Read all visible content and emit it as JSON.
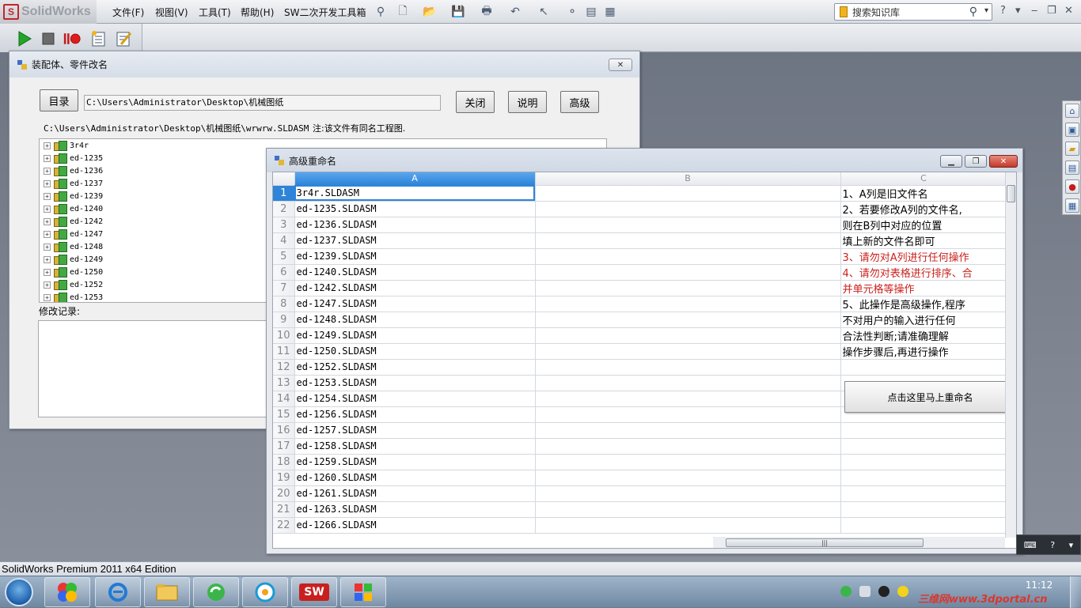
{
  "app": {
    "logo_text": "SolidWorks",
    "logo_mark": "S",
    "menu": [
      "文件(F)",
      "视图(V)",
      "工具(T)",
      "帮助(H)",
      "SW二次开发工具箱"
    ],
    "search_placeholder": "搜索知识库",
    "help_glyph": "?",
    "status_text": "SolidWorks Premium 2011 x64 Edition"
  },
  "rename_dialog": {
    "title": "装配体、零件改名",
    "close_glyph": "✕",
    "dir_button": "目录",
    "path_value": "C:\\Users\\Administrator\\Desktop\\机械图纸",
    "close_button": "关闭",
    "help_button": "说明",
    "advanced_button": "高级",
    "file_path": "C:\\Users\\Administrator\\Desktop\\机械图纸\\wrwrw.SLDASM",
    "note": "注:该文件有同名工程图.",
    "tree_items": [
      "3r4r",
      "ed-1235",
      "ed-1236",
      "ed-1237",
      "ed-1239",
      "ed-1240",
      "ed-1242",
      "ed-1247",
      "ed-1248",
      "ed-1249",
      "ed-1250",
      "ed-1252",
      "ed-1253"
    ],
    "log_label": "修改记录:"
  },
  "advanced_dialog": {
    "title": "高级重命名",
    "columns": [
      "A",
      "B",
      "C"
    ],
    "rows": [
      {
        "num": "1",
        "a": "3r4r.SLDASM",
        "c": "1、A列是旧文件名",
        "red": false
      },
      {
        "num": "2",
        "a": "ed-1235.SLDASM",
        "c": "2、若要修改A列的文件名,",
        "red": false
      },
      {
        "num": "3",
        "a": "ed-1236.SLDASM",
        "c": "则在B列中对应的位置",
        "red": false
      },
      {
        "num": "4",
        "a": "ed-1237.SLDASM",
        "c": "填上新的文件名即可",
        "red": false
      },
      {
        "num": "5",
        "a": "ed-1239.SLDASM",
        "c": "3、请勿对A列进行任何操作",
        "red": true
      },
      {
        "num": "6",
        "a": "ed-1240.SLDASM",
        "c": "4、请勿对表格进行排序、合",
        "red": true
      },
      {
        "num": "7",
        "a": "ed-1242.SLDASM",
        "c": "并单元格等操作",
        "red": true
      },
      {
        "num": "8",
        "a": "ed-1247.SLDASM",
        "c": "5、此操作是高级操作,程序",
        "red": false
      },
      {
        "num": "9",
        "a": "ed-1248.SLDASM",
        "c": "不对用户的输入进行任何",
        "red": false
      },
      {
        "num": "10",
        "a": "ed-1249.SLDASM",
        "c": "合法性判断;请准确理解",
        "red": false
      },
      {
        "num": "11",
        "a": "ed-1250.SLDASM",
        "c": "操作步骤后,再进行操作",
        "red": false
      },
      {
        "num": "12",
        "a": "ed-1252.SLDASM",
        "c": "",
        "red": false
      },
      {
        "num": "13",
        "a": "ed-1253.SLDASM",
        "c": "",
        "red": false
      },
      {
        "num": "14",
        "a": "ed-1254.SLDASM",
        "c": "",
        "red": false
      },
      {
        "num": "15",
        "a": "ed-1256.SLDASM",
        "c": "",
        "red": false
      },
      {
        "num": "16",
        "a": "ed-1257.SLDASM",
        "c": "",
        "red": false
      },
      {
        "num": "17",
        "a": "ed-1258.SLDASM",
        "c": "",
        "red": false
      },
      {
        "num": "18",
        "a": "ed-1259.SLDASM",
        "c": "",
        "red": false
      },
      {
        "num": "19",
        "a": "ed-1260.SLDASM",
        "c": "",
        "red": false
      },
      {
        "num": "20",
        "a": "ed-1261.SLDASM",
        "c": "",
        "red": false
      },
      {
        "num": "21",
        "a": "ed-1263.SLDASM",
        "c": "",
        "red": false
      },
      {
        "num": "22",
        "a": "ed-1266.SLDASM",
        "c": "",
        "red": false
      }
    ],
    "rename_button": "点击这里马上重命名",
    "min_glyph": "▁",
    "restore_glyph": "❐",
    "close_glyph": "✕",
    "scroll_grip": "|||"
  },
  "taskbar": {
    "time": "11:12",
    "watermark": "三维网www.3dportal.cn",
    "sw_button": "SW"
  },
  "colors": {
    "warning_red": "#c9211e",
    "selection_blue": "#2d84d8"
  }
}
